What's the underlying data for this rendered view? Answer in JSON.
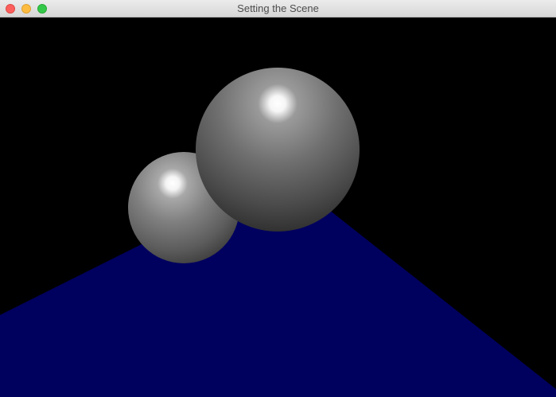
{
  "window": {
    "title": "Setting the Scene"
  },
  "scene": {
    "background_color": "#000000",
    "floor_color": "#00005f",
    "sphere_color": "#6f6f6f",
    "highlight_color": "#ffffff",
    "spheres": [
      {
        "name": "small-sphere"
      },
      {
        "name": "large-sphere"
      }
    ]
  },
  "colors": {
    "close": "#fc605c",
    "minimize": "#fdbc40",
    "zoom": "#34c84a"
  }
}
